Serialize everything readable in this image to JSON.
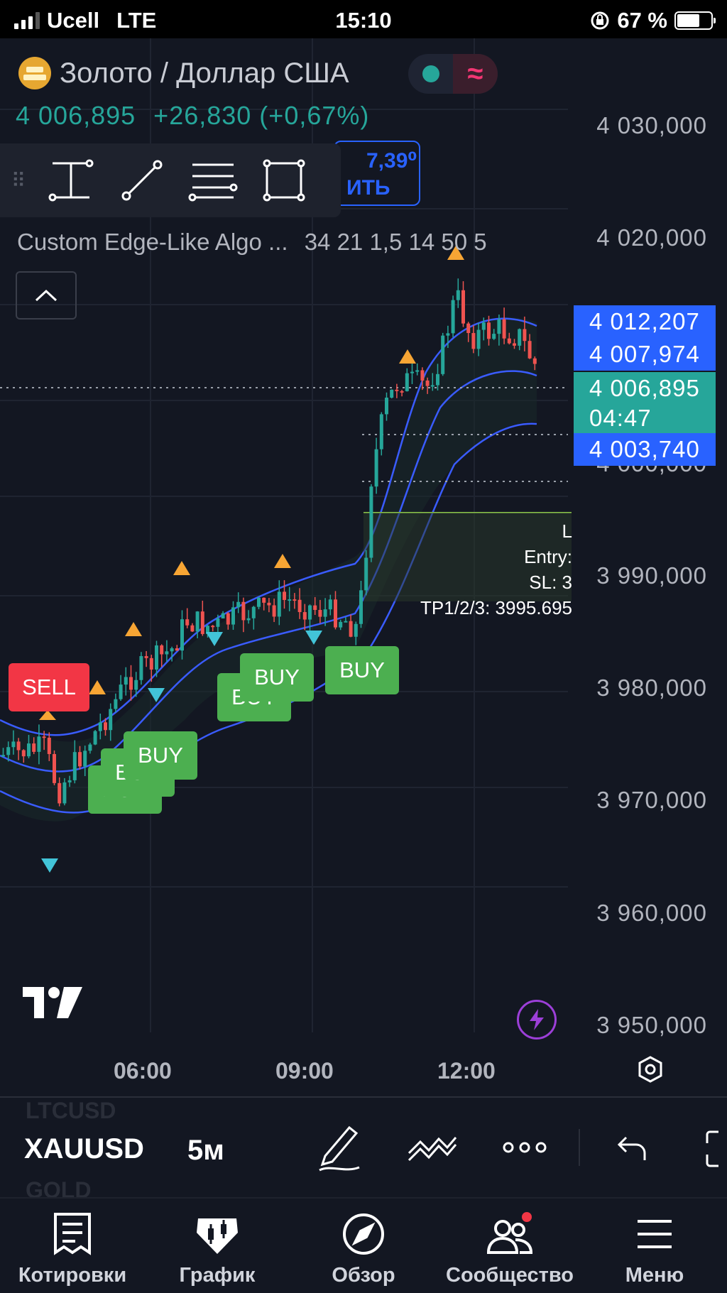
{
  "status_bar": {
    "carrier": "Ucell",
    "network": "LTE",
    "time": "15:10",
    "battery": "67 %"
  },
  "header": {
    "symbol_name": "Золото / Доллар США",
    "price": "4 006,895",
    "change": "+26,830 (+0,67%)",
    "buy_button_line1": "7,39⁰",
    "buy_button_line2": "ИТЬ"
  },
  "indicator": {
    "name": "Custom Edge-Like Algo ...",
    "params": "34 21 1,5 14 50 5"
  },
  "price_axis": [
    "4 030,000",
    "4 020,000",
    "4 000,000",
    "3 990,000",
    "3 980,000",
    "3 970,000",
    "3 960,000",
    "3 950,000"
  ],
  "price_tags": [
    {
      "value": "4 012,207",
      "color": "#2962ff"
    },
    {
      "value": "4 007,974",
      "color": "#2962ff"
    },
    {
      "value": "4 006,895",
      "sub": "04:47",
      "color": "#26a69a"
    },
    {
      "value": "4 003,740",
      "color": "#2962ff"
    }
  ],
  "time_axis": [
    "06:00",
    "09:00",
    "12:00"
  ],
  "signals": {
    "sell": "SELL",
    "buy": "BUY"
  },
  "trade_box": {
    "line1": "L",
    "entry": "Entry:",
    "sl": "SL: 3",
    "tp": "TP1/2/3: 3995.695"
  },
  "chips_bar": {
    "symbol": "XAUUSD",
    "prev_symbol": "LTCUSD",
    "next_symbol": "GOLD",
    "interval": "5м"
  },
  "bottom_nav": [
    {
      "label": "Котировки",
      "icon": "quotes-icon"
    },
    {
      "label": "График",
      "icon": "chart-icon"
    },
    {
      "label": "Обзор",
      "icon": "compass-icon"
    },
    {
      "label": "Сообщество",
      "icon": "community-icon"
    },
    {
      "label": "Меню",
      "icon": "menu-icon"
    }
  ],
  "colors": {
    "up": "#26a69a",
    "down": "#ef5350",
    "buy": "#4caf50",
    "sell": "#f23645",
    "accent": "#2962ff",
    "background": "#131722"
  }
}
